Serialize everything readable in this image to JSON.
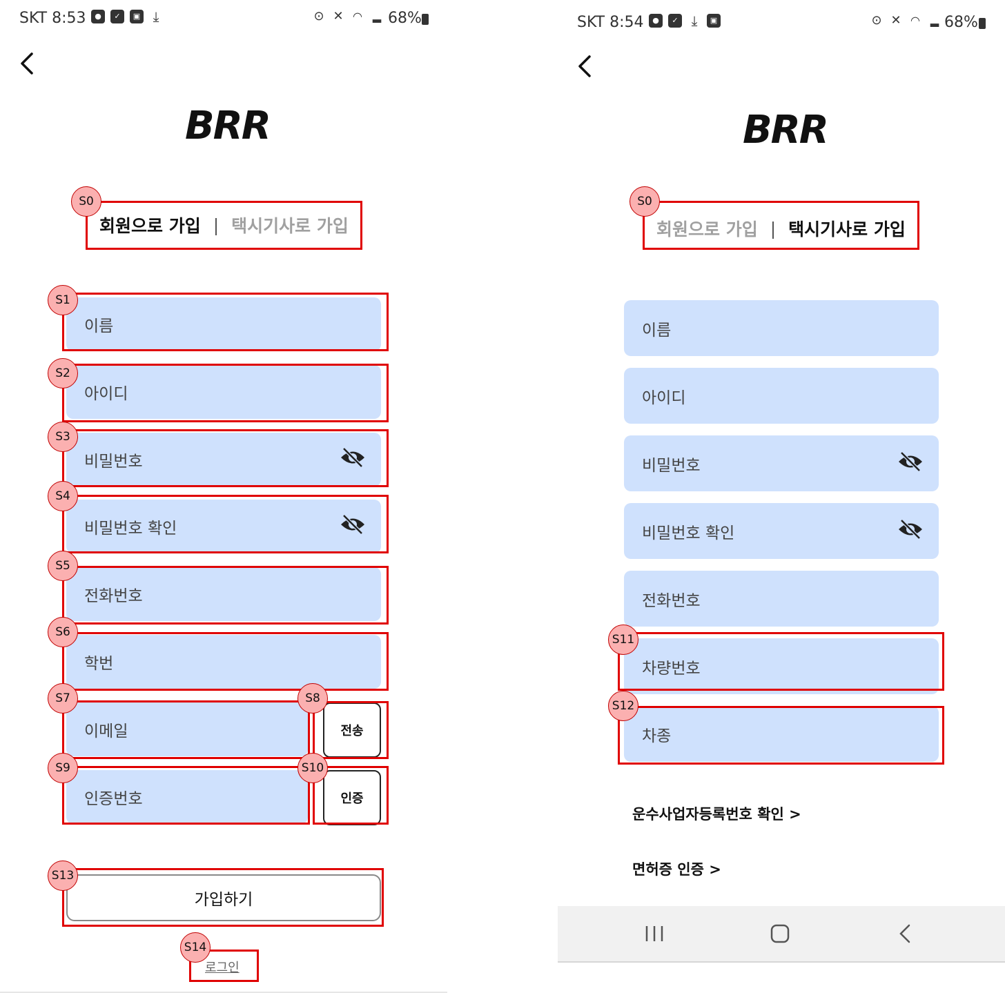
{
  "left": {
    "status": {
      "carrier_time": "SKT 8:53",
      "battery": "68%"
    },
    "logo": "BRR",
    "tabs": {
      "member": "회원으로 가입",
      "separator": "|",
      "driver": "택시기사로 가입"
    },
    "fields": {
      "name": "이름",
      "id": "아이디",
      "password": "비밀번호",
      "password_confirm": "비밀번호 확인",
      "phone": "전화번호",
      "student_id": "학번",
      "email": "이메일",
      "auth_code": "인증번호"
    },
    "buttons": {
      "send": "전송",
      "verify": "인증",
      "signup": "가입하기"
    },
    "login_link": "로그인"
  },
  "right": {
    "status": {
      "carrier_time": "SKT 8:54",
      "battery": "68%"
    },
    "logo": "BRR",
    "tabs": {
      "member": "회원으로 가입",
      "separator": "|",
      "driver": "택시기사로 가입"
    },
    "fields": {
      "name": "이름",
      "id": "아이디",
      "password": "비밀번호",
      "password_confirm": "비밀번호 확인",
      "phone": "전화번호",
      "car_number": "차량번호",
      "car_type": "차종"
    },
    "links": {
      "business_reg": "운수사업자등록번호 확인 >",
      "license": "면허증 인증 >"
    }
  },
  "annotations": [
    "S0",
    "S1",
    "S2",
    "S3",
    "S4",
    "S5",
    "S6",
    "S7",
    "S8",
    "S9",
    "S10",
    "S13",
    "S14",
    "S0",
    "S11",
    "S12"
  ],
  "colors": {
    "field_bg": "#cfe1fd",
    "annotation": "#e00000",
    "badge_bg": "#fbb0b0"
  }
}
